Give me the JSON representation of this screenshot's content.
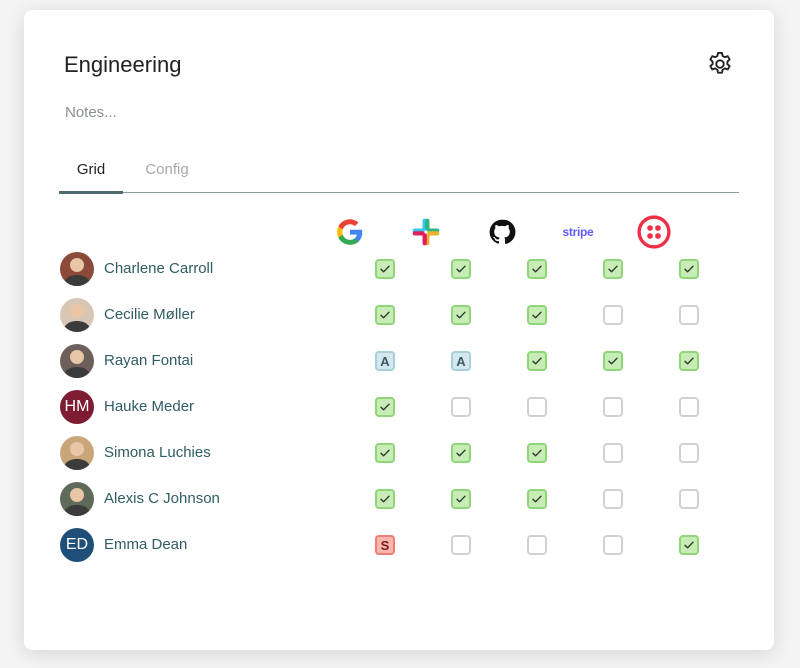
{
  "header": {
    "title": "Engineering",
    "notes_placeholder": "Notes..."
  },
  "tabs": [
    {
      "label": "Grid",
      "active": true
    },
    {
      "label": "Config",
      "active": false
    }
  ],
  "apps": [
    {
      "name": "Google",
      "icon": "google-icon"
    },
    {
      "name": "Slack",
      "icon": "slack-icon"
    },
    {
      "name": "GitHub",
      "icon": "github-icon"
    },
    {
      "name": "Stripe",
      "icon": "stripe-icon",
      "text": "stripe"
    },
    {
      "name": "Twilio",
      "icon": "twilio-icon"
    }
  ],
  "colors": {
    "checked_fill": "#c7ecb5",
    "checked_border": "#8fd67a",
    "admin_fill": "#d5e8ee",
    "suspended_fill": "#f8b6b1",
    "tab_underline": "#4d6e70",
    "name_text": "#2f5d63"
  },
  "users": [
    {
      "name": "Charlene Carroll",
      "avatar_type": "photo",
      "avatar_color": "#8b4a3a",
      "access": [
        "checked",
        "checked",
        "checked",
        "checked",
        "checked"
      ]
    },
    {
      "name": "Cecilie Møller",
      "avatar_type": "photo",
      "avatar_color": "#d8c7b5",
      "access": [
        "checked",
        "checked",
        "checked",
        "empty",
        "empty"
      ]
    },
    {
      "name": "Rayan Fontai",
      "avatar_type": "photo",
      "avatar_color": "#6d5f59",
      "access": [
        "A",
        "A",
        "checked",
        "checked",
        "checked"
      ]
    },
    {
      "name": "Hauke Meder",
      "avatar_type": "initials",
      "initials": "HM",
      "avatar_color": "#7d1c33",
      "access": [
        "checked",
        "empty",
        "empty",
        "empty",
        "empty"
      ]
    },
    {
      "name": "Simona Luchies",
      "avatar_type": "photo",
      "avatar_color": "#c9a67a",
      "access": [
        "checked",
        "checked",
        "checked",
        "empty",
        "empty"
      ]
    },
    {
      "name": "Alexis C Johnson",
      "avatar_type": "photo",
      "avatar_color": "#5f6a5a",
      "access": [
        "checked",
        "checked",
        "checked",
        "empty",
        "empty"
      ]
    },
    {
      "name": "Emma Dean",
      "avatar_type": "initials",
      "initials": "ED",
      "avatar_color": "#1f4f78",
      "access": [
        "S",
        "empty",
        "empty",
        "empty",
        "checked"
      ]
    }
  ]
}
